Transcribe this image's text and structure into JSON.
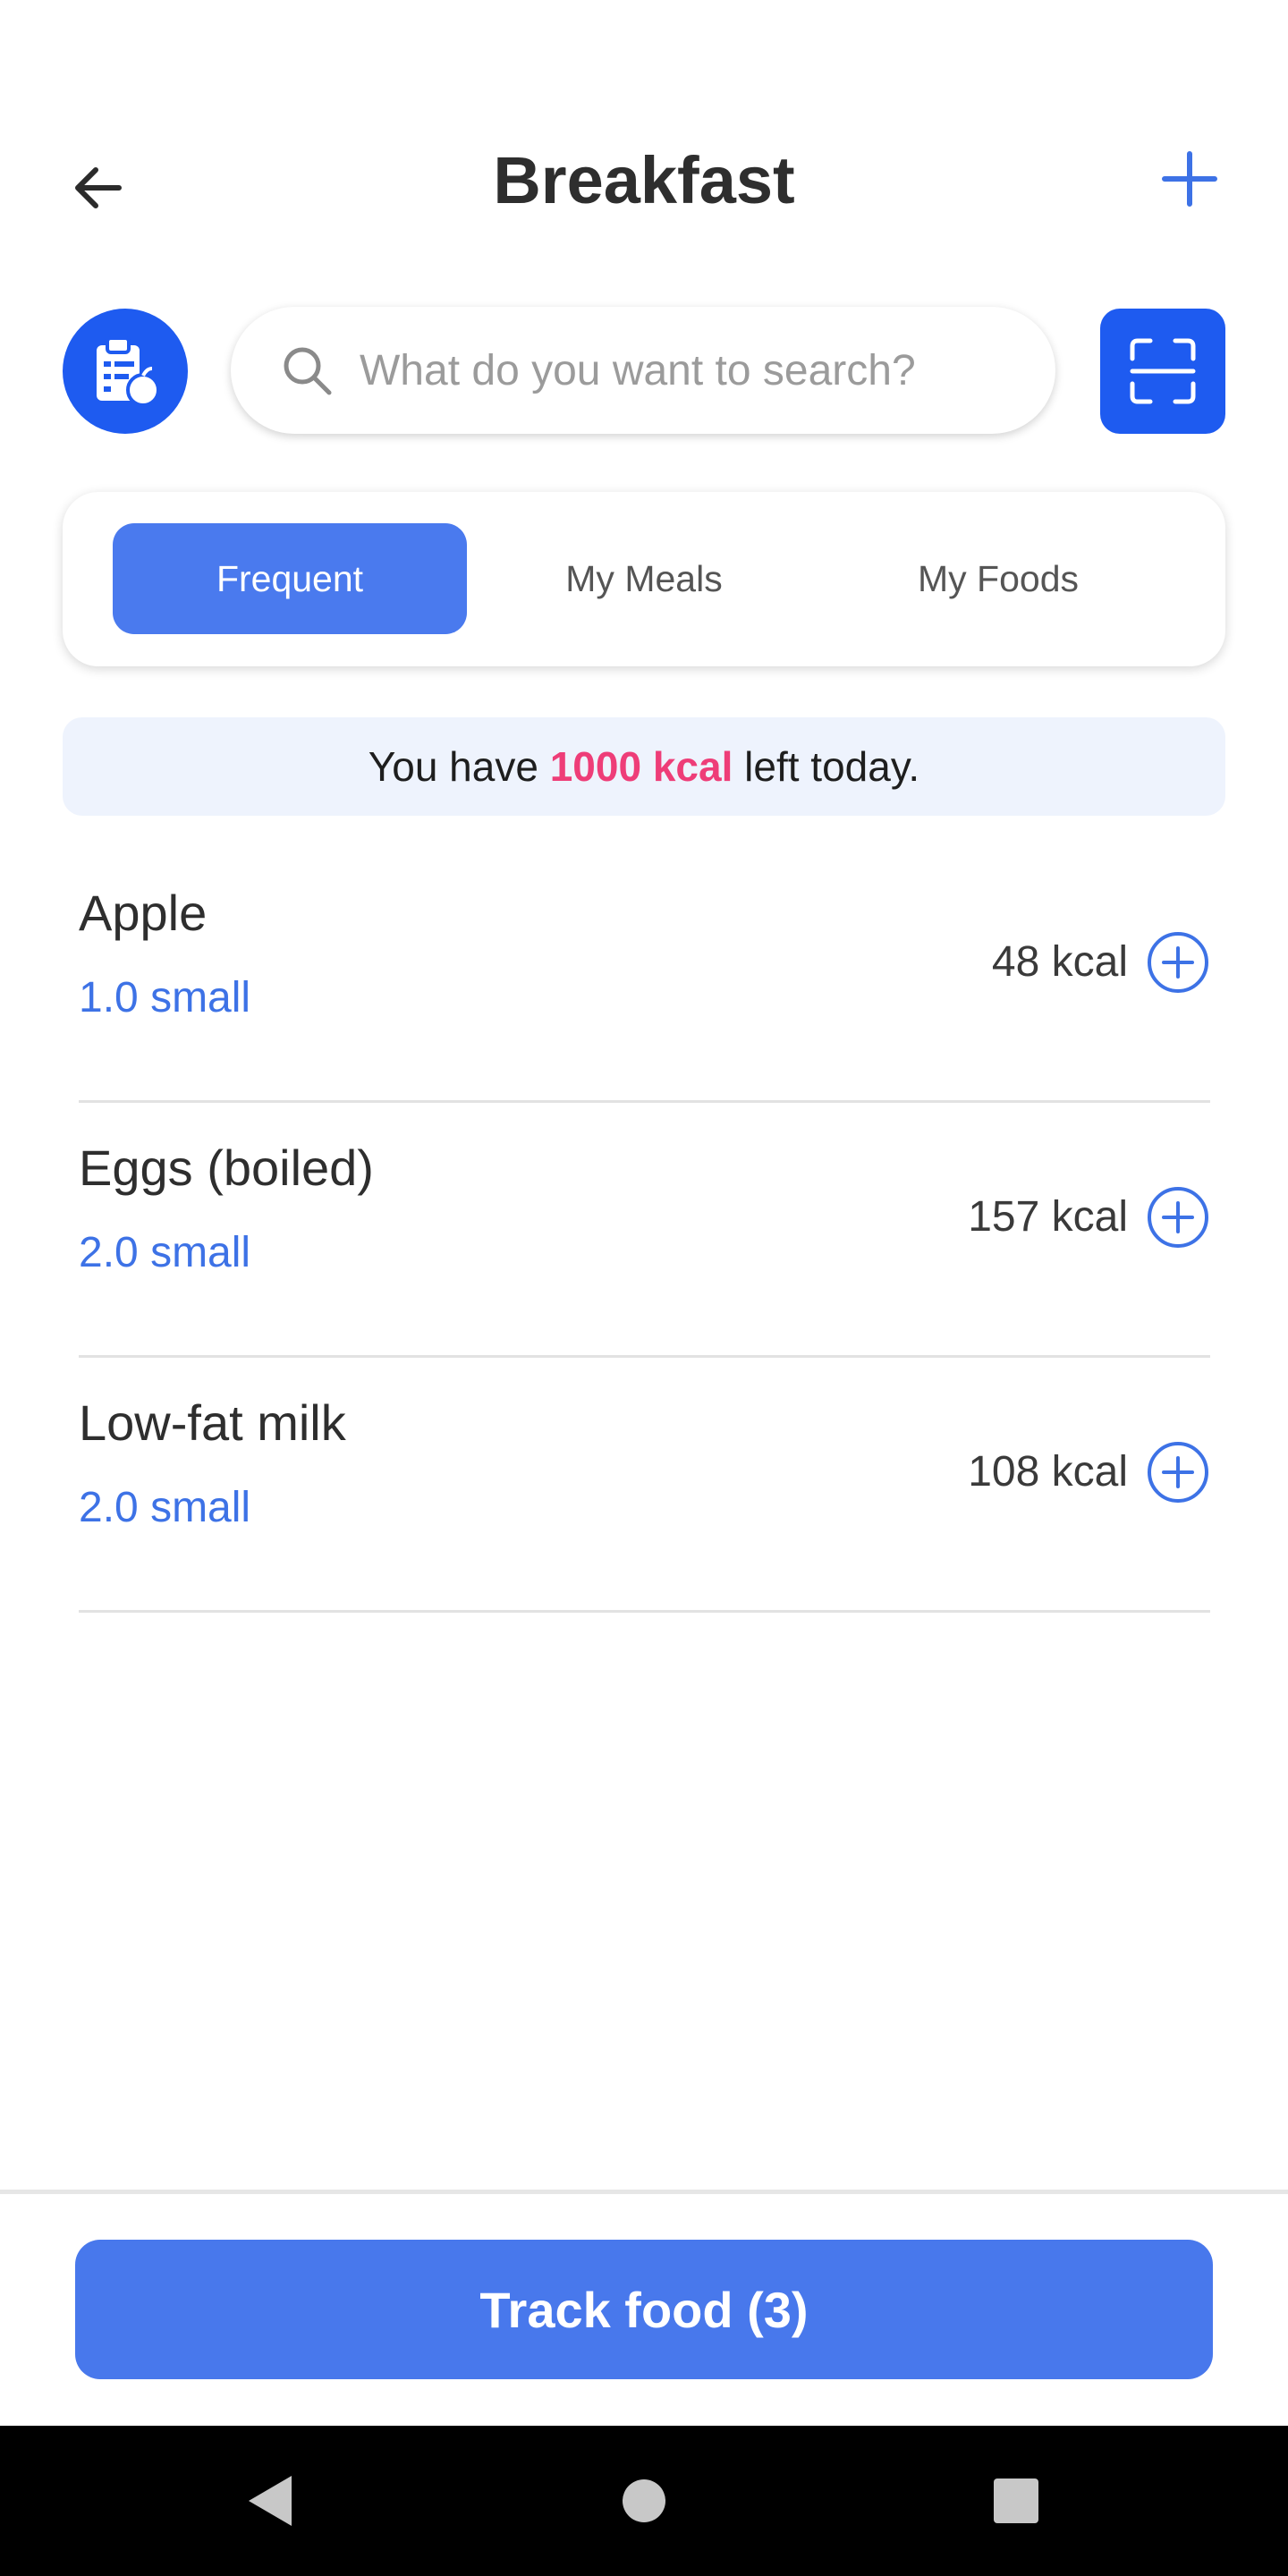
{
  "header": {
    "title": "Breakfast",
    "back_icon": "arrow-left-icon",
    "add_icon": "plus-icon"
  },
  "search": {
    "placeholder": "What do you want to search?",
    "value": "",
    "diary_icon": "clipboard-apple-icon",
    "scan_icon": "barcode-scan-icon"
  },
  "tabs": [
    {
      "label": "Frequent",
      "active": true
    },
    {
      "label": "My Meals",
      "active": false
    },
    {
      "label": "My Foods",
      "active": false
    }
  ],
  "kcal_banner": {
    "prefix": "You have ",
    "value": "1000 kcal",
    "suffix": " left today."
  },
  "foods": [
    {
      "name": "Apple",
      "portion": "1.0 small",
      "kcal": "48 kcal"
    },
    {
      "name": "Eggs (boiled)",
      "portion": "2.0 small",
      "kcal": "157 kcal"
    },
    {
      "name": "Low-fat milk",
      "portion": "2.0 small",
      "kcal": "108 kcal"
    }
  ],
  "track_button": {
    "label": "Track food (3)"
  },
  "colors": {
    "primary": "#1e5bf0",
    "tab_active": "#4a7aee",
    "accent_kcal": "#ee3d78",
    "portion_text": "#3d72e6",
    "track_button": "#4878ec",
    "banner_bg": "#eef3fd"
  },
  "nav": {
    "back": "nav-back-icon",
    "home": "nav-home-icon",
    "recents": "nav-recents-icon"
  }
}
